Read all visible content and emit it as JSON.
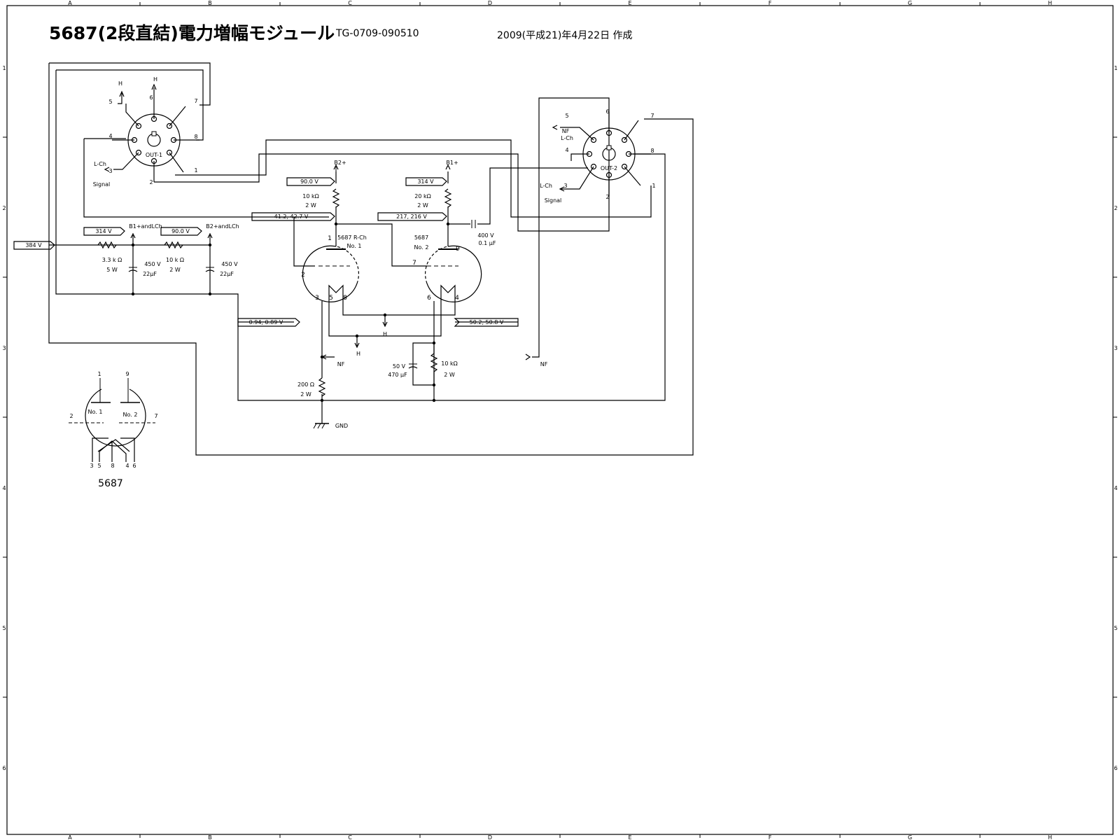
{
  "header": {
    "title": "5687(2段直結)電力増幅モジュール",
    "doc_no": "TG-0709-090510",
    "date": "2009(平成21)年4月22日  作成"
  },
  "frame": {
    "columns": [
      "A",
      "B",
      "C",
      "D",
      "E",
      "F",
      "G",
      "H"
    ],
    "rows": [
      "1",
      "2",
      "3",
      "4",
      "5",
      "6"
    ]
  },
  "rails": {
    "b2_label": "B2+",
    "b1_label": "B1+",
    "b1_lch": "B1+andLCh",
    "b2_lch": "B2+andLCh"
  },
  "voltage_tags": {
    "input": "384 V",
    "b1_supply": "314 V",
    "b2_supply": "90.0 V",
    "b2_node": "90.0 V",
    "b1_node": "314 V",
    "plate1": "41.2, 42.7 V",
    "plate2": "217, 216 V",
    "cathode1": "0.94, 0.89 V",
    "cathode2": "50.2, 50.8 V"
  },
  "components": {
    "r_supply1": {
      "value": "3.3 k Ω",
      "rating": "5 W"
    },
    "r_supply2": {
      "value": "10 k Ω",
      "rating": "2 W"
    },
    "c_supply1": {
      "value": "450 V",
      "cap": "22μF"
    },
    "c_supply2": {
      "value": "450 V",
      "cap": "22μF"
    },
    "r_plate1": {
      "value": "10 kΩ",
      "rating": "2 W"
    },
    "r_plate2": {
      "value": "20 kΩ",
      "rating": "2 W"
    },
    "c_out": {
      "value": "400 V",
      "cap": "0.1 μF"
    },
    "r_cath1": {
      "value": "200 Ω",
      "rating": "2 W"
    },
    "r_cath2": {
      "value": "10 kΩ",
      "rating": "2 W"
    },
    "c_cath2": {
      "value": "50 V",
      "cap": "470 μF"
    }
  },
  "tubes": {
    "tube1_name": "5687 R-Ch",
    "tube1_unit": "No. 1",
    "tube2_name": "5687",
    "tube2_unit": "No. 2",
    "pins": [
      "1",
      "2",
      "3",
      "5",
      "8",
      "9",
      "7",
      "6",
      "4"
    ]
  },
  "connectors": {
    "out1": {
      "name": "OUT-1",
      "pins": [
        "1",
        "2",
        "3",
        "4",
        "5",
        "6",
        "7",
        "8"
      ],
      "heater_a": "H",
      "heater_b": "H",
      "label_ch": "L-Ch",
      "label_sig": "Signal"
    },
    "out2": {
      "name": "OUT-2",
      "pins": [
        "1",
        "2",
        "3",
        "4",
        "5",
        "6",
        "7",
        "8"
      ],
      "label_nf": "NF",
      "label_ch_top": "L-Ch",
      "label_ch": "L-Ch",
      "label_sig": "Signal"
    }
  },
  "misc_labels": {
    "nf1": "NF",
    "nf2": "NF",
    "h1": "H",
    "h2": "H",
    "gnd": "GND"
  },
  "pinout": {
    "title": "5687",
    "unit1": "No. 1",
    "unit2": "No. 2",
    "pins": [
      "1",
      "9",
      "2",
      "7",
      "3",
      "5",
      "8",
      "4",
      "6"
    ]
  }
}
